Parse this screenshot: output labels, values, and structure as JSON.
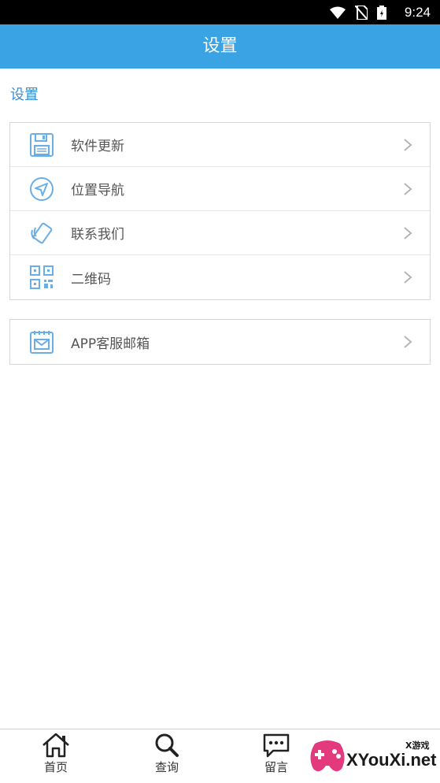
{
  "status_bar": {
    "time": "9:24"
  },
  "header": {
    "title": "设置"
  },
  "section": {
    "title": "设置"
  },
  "groups": {
    "main": [
      {
        "label": "软件更新",
        "icon": "save-icon"
      },
      {
        "label": "位置导航",
        "icon": "navigation-icon"
      },
      {
        "label": "联系我们",
        "icon": "phone-icon"
      },
      {
        "label": "二维码",
        "icon": "qrcode-icon"
      }
    ],
    "mail": [
      {
        "label": "APP客服邮箱",
        "icon": "mail-icon"
      }
    ]
  },
  "bottom_nav": {
    "home": "首页",
    "search": "查询",
    "message": "留言"
  },
  "watermark": {
    "text": "XYouXi.net",
    "small": "X游戏"
  },
  "colors": {
    "accent": "#3aa3e3",
    "icon_blue": "#6aaee6",
    "section_title": "#3a8fd4"
  }
}
